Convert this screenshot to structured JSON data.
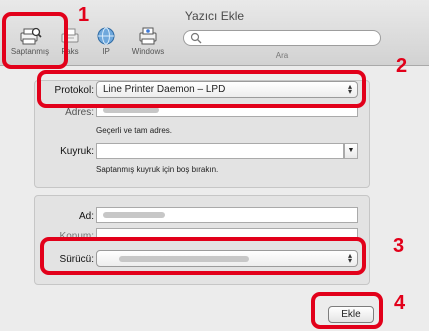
{
  "window": {
    "title": "Yazıcı Ekle"
  },
  "toolbar": {
    "default_label": "Saptanmış",
    "fax_label": "Faks",
    "ip_label": "IP",
    "windows_label": "Windows",
    "search_label": "Ara",
    "search_placeholder": ""
  },
  "protocol": {
    "label": "Protokol:",
    "value": "Line Printer Daemon – LPD"
  },
  "address": {
    "label": "Adres:",
    "hint": "Geçerli ve tam adres."
  },
  "queue": {
    "label": "Kuyruk:",
    "value": "",
    "hint": "Saptanmış kuyruk için boş bırakın."
  },
  "name": {
    "label": "Ad:"
  },
  "location": {
    "label": "Konum:"
  },
  "driver": {
    "label": "Sürücü:"
  },
  "buttons": {
    "add_label": "Ekle"
  },
  "callouts": {
    "one": "1",
    "two": "2",
    "three": "3",
    "four": "4"
  },
  "colors": {
    "highlight": "#e2001a"
  }
}
